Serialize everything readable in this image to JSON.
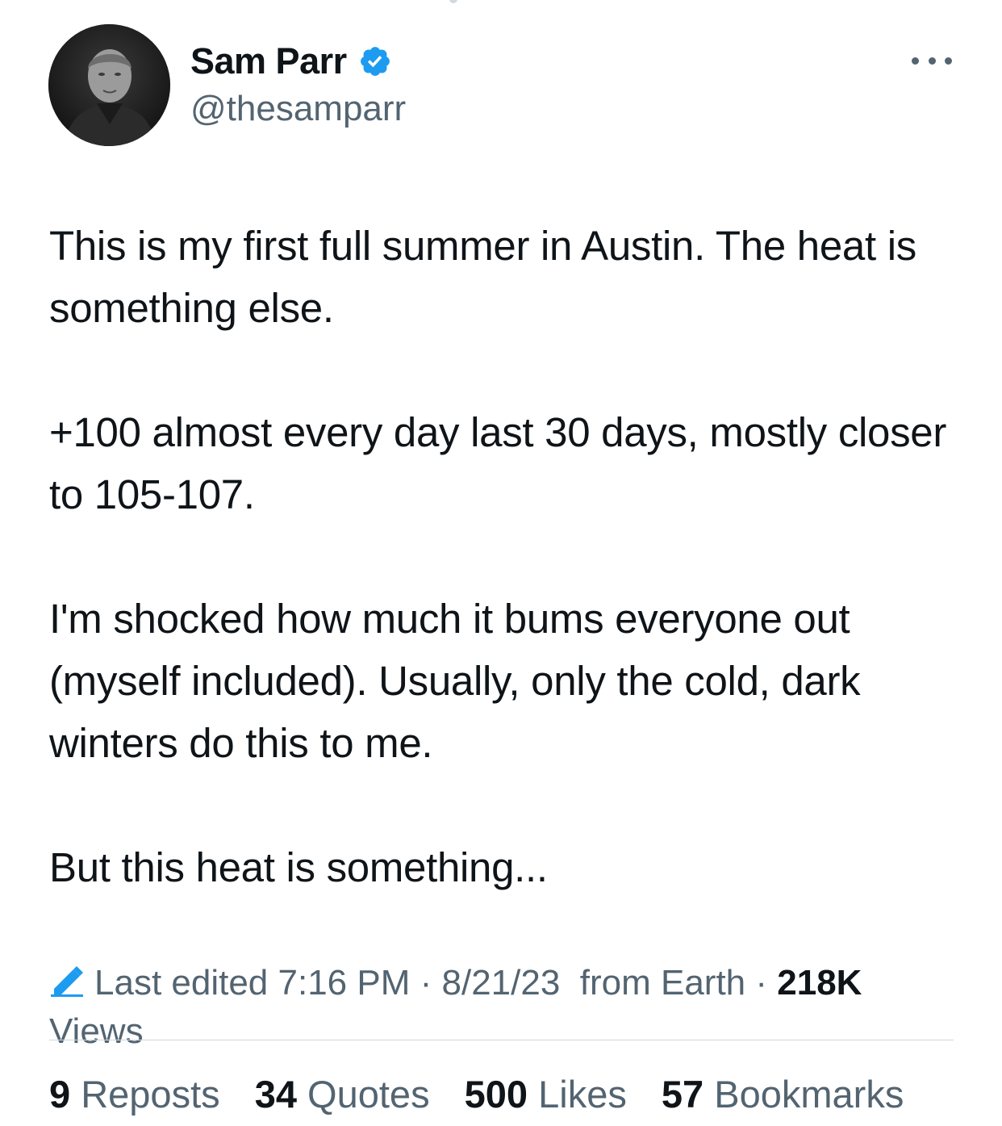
{
  "tweet": {
    "author": {
      "name": "Sam Parr",
      "handle": "@thesamparr",
      "verified": true
    },
    "paragraphs": [
      "This is my first full summer in Austin. The heat is something else.",
      "+100 almost every day last 30 days, mostly closer to 105-107.",
      "I'm shocked how much it bums everyone out (myself included). Usually, only the cold, dark winters do this to me.",
      "But this heat is something..."
    ],
    "meta": {
      "edited_label": "Last edited",
      "time": "7:16 PM",
      "separator": " · ",
      "date": "8/21/23",
      "location": "from Earth",
      "views_count": "218K",
      "views_label": "Views"
    },
    "stats": [
      {
        "count": "9",
        "label": "Reposts"
      },
      {
        "count": "34",
        "label": "Quotes"
      },
      {
        "count": "500",
        "label": "Likes"
      },
      {
        "count": "57",
        "label": "Bookmarks"
      }
    ]
  },
  "colors": {
    "text_primary": "#0f1419",
    "text_secondary": "#536471",
    "accent": "#1d9bf0",
    "divider": "#cfd9de"
  },
  "icons": [
    "verified-badge-icon",
    "more-options-icon",
    "edit-pencil-icon"
  ]
}
